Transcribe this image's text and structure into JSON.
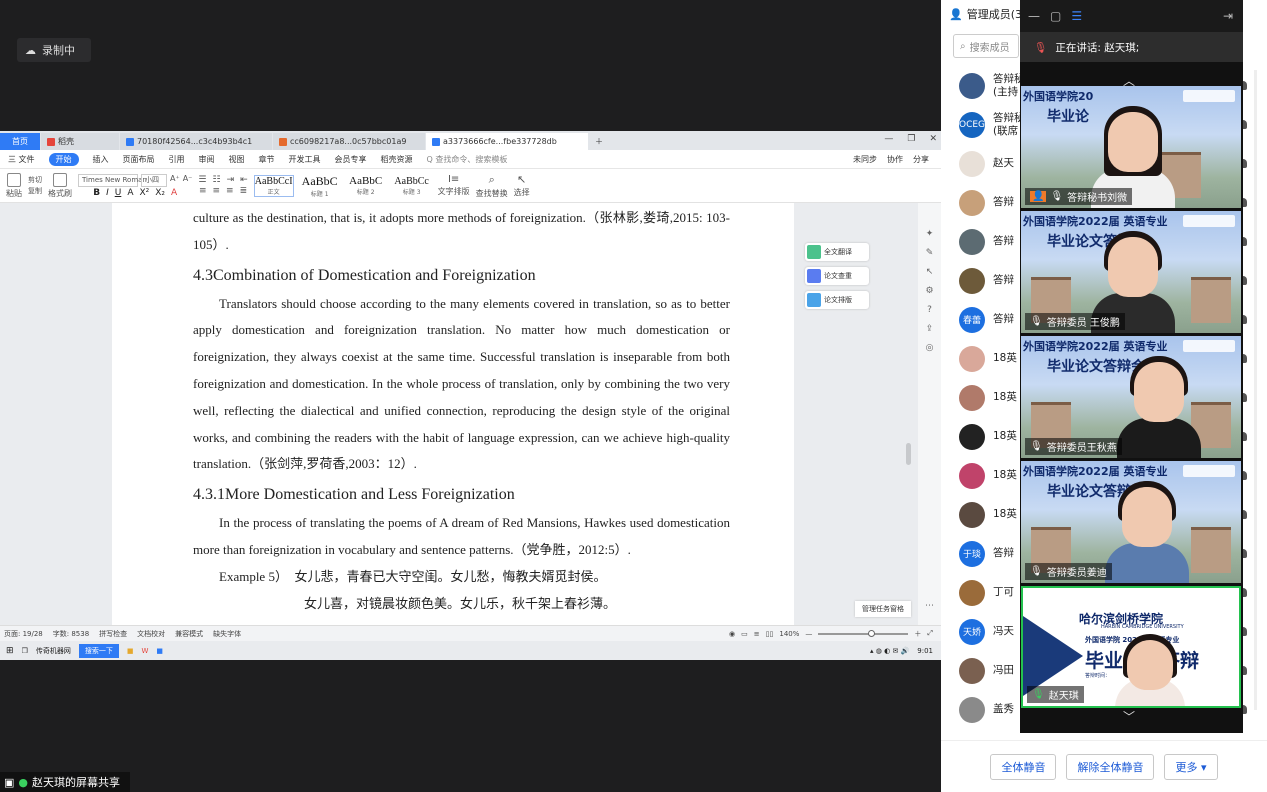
{
  "recording": {
    "label": "录制中"
  },
  "screen_share": {
    "label": "赵天琪的屏幕共享"
  },
  "wps": {
    "tabs": [
      "首页",
      "稻壳",
      "70180f42564...c3c4b93b4c1",
      "cc6098217a8...0c57bbc01a9",
      "a3373666cfe...fbe337728db"
    ],
    "menu": [
      "三 文件",
      "开始",
      "插入",
      "页面布局",
      "引用",
      "审阅",
      "视图",
      "章节",
      "开发工具",
      "会员专享",
      "稻壳资源",
      "Q 查找命令、搜索模板"
    ],
    "menu_right": [
      "未同步",
      "协作",
      "分享"
    ],
    "ribbon": {
      "paste": "粘贴",
      "format_painter": "格式刷",
      "cut": "剪切",
      "copy": "复制",
      "font": "Times New Roman",
      "size": "小四",
      "styles": [
        {
          "sample": "AaBbCcI",
          "name": "正文"
        },
        {
          "sample": "AaBbC",
          "name": "标题 1"
        },
        {
          "sample": "AaBbC",
          "name": "标题 2"
        },
        {
          "sample": "AaBbCc",
          "name": "标题 3"
        }
      ],
      "text_layout": "文字排版",
      "find_replace": "查找替换",
      "select": "选择"
    },
    "doc": {
      "p0": "culture as the destination, that is, it adopts more methods of foreignization.（张林影,娄琦,2015: 103-105）.",
      "h1": "4.3Combination of Domestication and Foreignization",
      "p1": "Translators should choose according to the many elements covered in translation, so as to better apply domestication and foreignization translation. No matter how much domestication or foreignization, they always coexist at the same time. Successful translation is inseparable from both foreignization and domestication. In the whole process of translation, only by combining the two very well, reflecting the dialectical and unified connection, reproducing the design style of the original works, and combining the readers with the habit of language expression, can we achieve high-quality translation.（张剑萍,罗荷香,2003：12）.",
      "h2": "4.3.1More Domestication and Less Foreignization",
      "p2": "In the process of translating the poems of A dream of Red Mansions, Hawkes used domestication more than foreignization in vocabulary and sentence patterns.（党争胜，2012:5）.",
      "ex_label": "Example 5）",
      "ex_line1": "女儿悲，青春已大守空闺。女儿愁，悔教夫婿觅封侯。",
      "ex_line2": "女儿喜，对镜晨妆颜色美。女儿乐，秋千架上春衫薄。"
    },
    "right_panel": [
      "全文翻译",
      "论文查重",
      "论文排版"
    ],
    "task_window": "管理任务窗格",
    "status": {
      "page": "页面: 19/28",
      "words": "字数: 8538",
      "spell": "拼写检查",
      "doc_check": "文档校对",
      "compat": "兼容模式",
      "font_missing": "缺失字体",
      "zoom": "140%",
      "zoom_level": 0.55
    },
    "taskbar": {
      "app": "传奇机器网",
      "search": "搜索一下",
      "time": "9:01"
    }
  },
  "members": {
    "title": "管理成员(3",
    "search_placeholder": "搜索成员",
    "list": [
      {
        "name": "答辩秘",
        "sub": "(主持",
        "avatar_color": "#3b5b8a"
      },
      {
        "name": "答辩秘",
        "sub": "(联席",
        "avatar_text": "OCEG",
        "avatar_color": "#1565c0"
      },
      {
        "name": "赵天",
        "sub": "",
        "avatar_color": "#e8e0d8"
      },
      {
        "name": "答辩",
        "sub": "",
        "avatar_color": "#c7a07a"
      },
      {
        "name": "答辩",
        "sub": "",
        "avatar_color": "#5c6b72"
      },
      {
        "name": "答辩",
        "sub": "",
        "avatar_color": "#6d5a3a"
      },
      {
        "name": "答辩",
        "sub": "",
        "avatar_text": "春蕾",
        "avatar_color": "#1d6fe0"
      },
      {
        "name": "18英",
        "sub": "",
        "avatar_color": "#d9a89a"
      },
      {
        "name": "18英",
        "sub": "",
        "avatar_color": "#b07a6a"
      },
      {
        "name": "18英",
        "sub": "",
        "avatar_color": "#222222"
      },
      {
        "name": "18英",
        "sub": "",
        "avatar_color": "#c0436a"
      },
      {
        "name": "18英",
        "sub": "",
        "avatar_color": "#5a4a40"
      },
      {
        "name": "答辩",
        "sub": "",
        "avatar_text": "于琰",
        "avatar_color": "#1d6fe0"
      },
      {
        "name": "丁可",
        "sub": "",
        "avatar_color": "#9a6b3a"
      },
      {
        "name": "冯天",
        "sub": "",
        "avatar_text": "天娇",
        "avatar_color": "#1d6fe0"
      },
      {
        "name": "冯田",
        "sub": "",
        "avatar_color": "#7a6050"
      },
      {
        "name": "盖秀",
        "sub": "",
        "avatar_color": "#8a8a8a"
      }
    ],
    "buttons": [
      "全体静音",
      "解除全体静音",
      "更多 ▾"
    ]
  },
  "videos": {
    "speaking": "正在讲话: 赵天琪;",
    "tiles": [
      {
        "title": "外国语学院20",
        "subtitle": "毕业论",
        "label": "答辩秘书刘微"
      },
      {
        "title": "外国语学院2022届  英语专业",
        "subtitle": "毕业论文答辩会",
        "label": "答辩委员 王俊鹏"
      },
      {
        "title": "外国语学院2022届  英语专业",
        "subtitle": "毕业论文答辩会",
        "label": "答辩委员王秋燕"
      },
      {
        "title": "外国语学院2022届  英语专业",
        "subtitle": "毕业论文答辩会",
        "label": "答辩委员姜迪"
      },
      {
        "school": "哈尔滨剑桥学院",
        "school_en": "HARBIN CAMBRIDGE UNIVERSITY",
        "title": "外国语学院 2022届 英语专业",
        "subtitle": "毕业论文答辩",
        "date": "答辩时间：",
        "label": "赵天琪"
      }
    ]
  },
  "colors": {
    "accent": "#2f7bf5",
    "active_speaker": "#24c24f",
    "link": "#1d5bd6"
  }
}
